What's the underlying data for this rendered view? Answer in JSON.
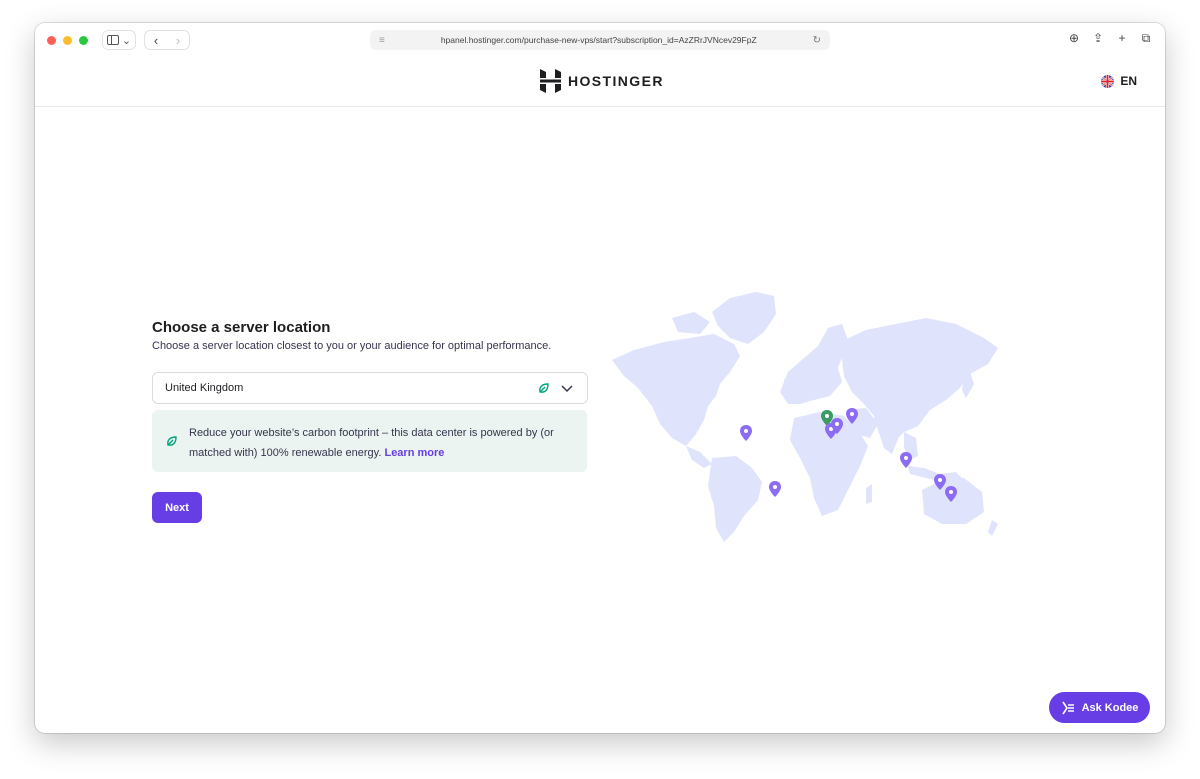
{
  "browser": {
    "url": "hpanel.hostinger.com/purchase-new-vps/start?subscription_id=AzZRrJVNcev29FpZ"
  },
  "header": {
    "logo_text": "HOSTINGER",
    "language": "EN"
  },
  "main": {
    "title": "Choose a server location",
    "subtitle": "Choose a server location closest to you or your audience for optimal performance.",
    "location_select": {
      "selected_value": "United Kingdom"
    },
    "info": {
      "text": "Reduce your website’s carbon footprint – this data center is powered by (or matched with) 100% renewable energy.",
      "link_label": "Learn more"
    },
    "next_label": "Next"
  },
  "map": {
    "land_color": "#dfe3fb",
    "pin_color": "#8c6cf3",
    "selected_pin_color": "#3a9c63",
    "pins": [
      "usa",
      "brazil",
      "uk",
      "france",
      "netherlands",
      "lithuania",
      "india",
      "malaysia",
      "singapore"
    ],
    "selected_pin": "uk"
  },
  "assistant": {
    "label": "Ask Kodee"
  },
  "colors": {
    "primary": "#673de6",
    "eco_bg": "#ebf4f0",
    "eco_green": "#00b090"
  }
}
